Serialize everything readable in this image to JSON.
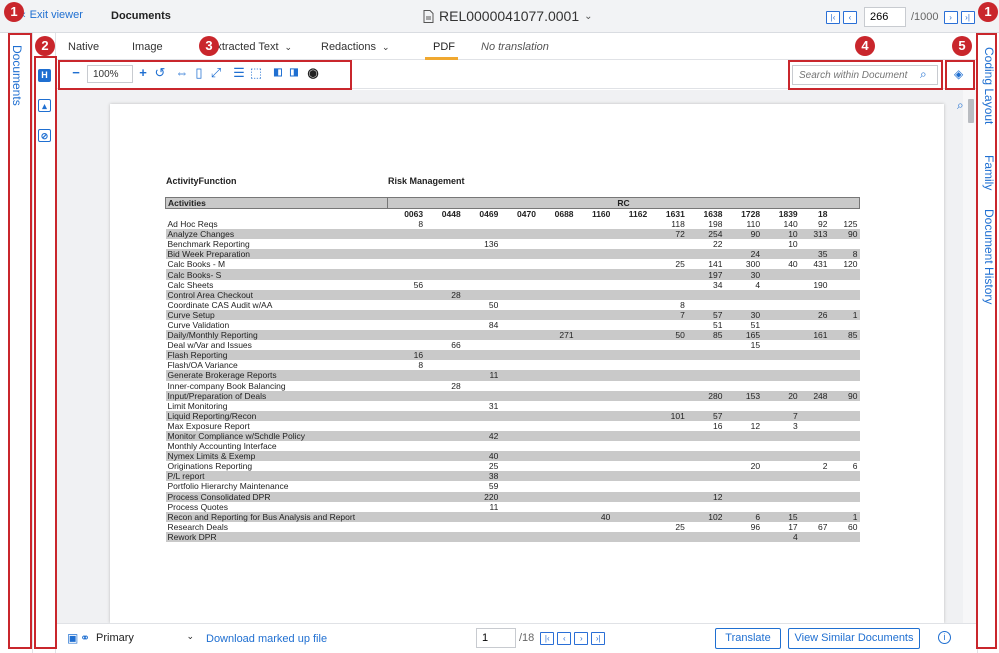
{
  "topbar": {
    "exit_label": "Exit viewer",
    "breadcrumb": "Documents",
    "doc_id": "REL0000041077.0001",
    "page_value": "266",
    "page_total": "/1000",
    "doc_icon": "document-icon",
    "chevron": "chevron-down-icon"
  },
  "left_rail": {
    "label": "Documents"
  },
  "right_rail": {
    "tabs": [
      "Coding Layout",
      "Family",
      "Document History"
    ]
  },
  "tabs": [
    {
      "label": "Native",
      "has_menu": false
    },
    {
      "label": "Image",
      "has_menu": false
    },
    {
      "label": "Extracted Text",
      "has_menu": true
    },
    {
      "label": "Redactions",
      "has_menu": true
    },
    {
      "label": "PDF",
      "has_menu": false,
      "active": true
    },
    {
      "label": "No translation",
      "has_menu": false
    }
  ],
  "toolbar": {
    "zoom": "100%",
    "search_placeholder": "Search within Document"
  },
  "markers": [
    "1",
    "2",
    "3",
    "4",
    "5",
    "1"
  ],
  "document": {
    "function_label": "ActivityFunction",
    "function_value": "Risk Management",
    "header_activities": "Activities",
    "header_rc": "RC",
    "codes": [
      "0063",
      "0448",
      "0469",
      "0470",
      "0688",
      "1160",
      "1162",
      "1631",
      "1638",
      "1728",
      "1839",
      "18"
    ],
    "rows": [
      {
        "name": "Ad Hoc Reqs",
        "shade": false,
        "v": [
          "8",
          "",
          "",
          "",
          "",
          "",
          "",
          "118",
          "198",
          "110",
          "140",
          "92",
          "125"
        ]
      },
      {
        "name": "Analyze Changes",
        "shade": true,
        "v": [
          "",
          "",
          "",
          "",
          "",
          "",
          "",
          "72",
          "254",
          "90",
          "10",
          "313",
          "90"
        ]
      },
      {
        "name": "Benchmark Reporting",
        "shade": false,
        "v": [
          "",
          "",
          "136",
          "",
          "",
          "",
          "",
          "",
          "22",
          "",
          "10",
          "",
          ""
        ]
      },
      {
        "name": "Bid Week Preparation",
        "shade": true,
        "v": [
          "",
          "",
          "",
          "",
          "",
          "",
          "",
          "",
          "",
          "24",
          "",
          "35",
          "8"
        ]
      },
      {
        "name": "Calc Books - M",
        "shade": false,
        "v": [
          "",
          "",
          "",
          "",
          "",
          "",
          "",
          "25",
          "141",
          "300",
          "40",
          "431",
          "120"
        ]
      },
      {
        "name": "Calc Books- S",
        "shade": true,
        "v": [
          "",
          "",
          "",
          "",
          "",
          "",
          "",
          "",
          "197",
          "30",
          "",
          "",
          ""
        ]
      },
      {
        "name": "Calc Sheets",
        "shade": false,
        "v": [
          "56",
          "",
          "",
          "",
          "",
          "",
          "",
          "",
          "34",
          "4",
          "",
          "190",
          ""
        ]
      },
      {
        "name": "Control Area Checkout",
        "shade": true,
        "v": [
          "",
          "28",
          "",
          "",
          "",
          "",
          "",
          "",
          "",
          "",
          "",
          "",
          ""
        ]
      },
      {
        "name": "Coordinate CAS Audit w/AA",
        "shade": false,
        "v": [
          "",
          "",
          "50",
          "",
          "",
          "",
          "",
          "8",
          "",
          "",
          "",
          "",
          ""
        ]
      },
      {
        "name": "Curve Setup",
        "shade": true,
        "v": [
          "",
          "",
          "",
          "",
          "",
          "",
          "",
          "7",
          "57",
          "30",
          "",
          "26",
          "1"
        ]
      },
      {
        "name": "Curve Validation",
        "shade": false,
        "v": [
          "",
          "",
          "84",
          "",
          "",
          "",
          "",
          "",
          "51",
          "51",
          "",
          "",
          ""
        ]
      },
      {
        "name": "Daily/Monthly Reporting",
        "shade": true,
        "v": [
          "",
          "",
          "",
          "",
          "271",
          "",
          "",
          "50",
          "85",
          "165",
          "",
          "161",
          "85"
        ]
      },
      {
        "name": "Deal w/Var and Issues",
        "shade": false,
        "v": [
          "",
          "66",
          "",
          "",
          "",
          "",
          "",
          "",
          "",
          "15",
          "",
          "",
          ""
        ]
      },
      {
        "name": "Flash Reporting",
        "shade": true,
        "v": [
          "16",
          "",
          "",
          "",
          "",
          "",
          "",
          "",
          "",
          "",
          "",
          "",
          ""
        ]
      },
      {
        "name": "Flash/OA Variance",
        "shade": false,
        "v": [
          "8",
          "",
          "",
          "",
          "",
          "",
          "",
          "",
          "",
          "",
          "",
          "",
          ""
        ]
      },
      {
        "name": "Generate Brokerage Reports",
        "shade": true,
        "v": [
          "",
          "",
          "11",
          "",
          "",
          "",
          "",
          "",
          "",
          "",
          "",
          "",
          ""
        ]
      },
      {
        "name": "Inner-company Book Balancing",
        "shade": false,
        "v": [
          "",
          "28",
          "",
          "",
          "",
          "",
          "",
          "",
          "",
          "",
          "",
          "",
          ""
        ]
      },
      {
        "name": "Input/Preparation of Deals",
        "shade": true,
        "v": [
          "",
          "",
          "",
          "",
          "",
          "",
          "",
          "",
          "280",
          "153",
          "20",
          "248",
          "90"
        ]
      },
      {
        "name": "Limit Monitoring",
        "shade": false,
        "v": [
          "",
          "",
          "31",
          "",
          "",
          "",
          "",
          "",
          "",
          "",
          "",
          "",
          ""
        ]
      },
      {
        "name": "Liquid Reporting/Recon",
        "shade": true,
        "v": [
          "",
          "",
          "",
          "",
          "",
          "",
          "",
          "101",
          "57",
          "",
          "7",
          "",
          ""
        ]
      },
      {
        "name": "Max Exposure Report",
        "shade": false,
        "v": [
          "",
          "",
          "",
          "",
          "",
          "",
          "",
          "",
          "16",
          "12",
          "3",
          "",
          ""
        ]
      },
      {
        "name": "Monitor Compliance w/Schdle Policy",
        "shade": true,
        "v": [
          "",
          "",
          "42",
          "",
          "",
          "",
          "",
          "",
          "",
          "",
          "",
          "",
          ""
        ]
      },
      {
        "name": "Monthly Accounting Interface",
        "shade": false,
        "v": [
          "",
          "",
          "",
          "",
          "",
          "",
          "",
          "",
          "",
          "",
          "",
          "",
          ""
        ]
      },
      {
        "name": "Nymex Limits & Exemp",
        "shade": true,
        "v": [
          "",
          "",
          "40",
          "",
          "",
          "",
          "",
          "",
          "",
          "",
          "",
          "",
          ""
        ]
      },
      {
        "name": "Originations Reporting",
        "shade": false,
        "v": [
          "",
          "",
          "25",
          "",
          "",
          "",
          "",
          "",
          "",
          "20",
          "",
          "2",
          "6"
        ]
      },
      {
        "name": "P/L report",
        "shade": true,
        "v": [
          "",
          "",
          "38",
          "",
          "",
          "",
          "",
          "",
          "",
          "",
          "",
          "",
          ""
        ]
      },
      {
        "name": "Portfolio Hierarchy Maintenance",
        "shade": false,
        "v": [
          "",
          "",
          "59",
          "",
          "",
          "",
          "",
          "",
          "",
          "",
          "",
          "",
          ""
        ]
      },
      {
        "name": "Process Consolidated DPR",
        "shade": true,
        "v": [
          "",
          "",
          "220",
          "",
          "",
          "",
          "",
          "",
          "12",
          "",
          "",
          "",
          ""
        ]
      },
      {
        "name": "Process Quotes",
        "shade": false,
        "v": [
          "",
          "",
          "11",
          "",
          "",
          "",
          "",
          "",
          "",
          "",
          "",
          "",
          ""
        ]
      },
      {
        "name": "Recon and Reporting for Bus Analysis and Report",
        "shade": true,
        "v": [
          "",
          "",
          "",
          "",
          "",
          "40",
          "",
          "",
          "102",
          "6",
          "15",
          "",
          "1"
        ]
      },
      {
        "name": "Research Deals",
        "shade": false,
        "v": [
          "",
          "",
          "",
          "",
          "",
          "",
          "",
          "25",
          "",
          "96",
          "17",
          "67",
          "60"
        ]
      },
      {
        "name": "Rework DPR",
        "shade": true,
        "v": [
          "",
          "",
          "",
          "",
          "",
          "",
          "",
          "",
          "",
          "",
          "4",
          "",
          ""
        ]
      }
    ]
  },
  "bottombar": {
    "select_value": "Primary",
    "download_label": "Download marked up file",
    "page_value": "1",
    "page_total": "/18",
    "translate_label": "Translate",
    "similar_label": "View Similar Documents"
  }
}
